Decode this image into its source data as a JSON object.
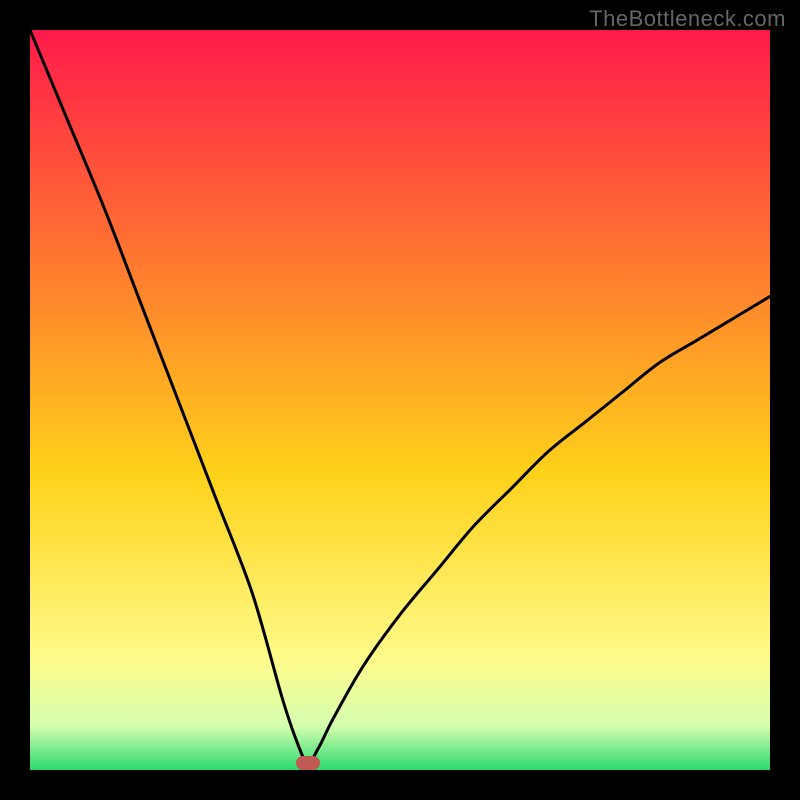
{
  "watermark": "TheBottleneck.com",
  "colors": {
    "frame": "#000000",
    "grad_top": "#ff1a4a",
    "grad_mid1": "#ff7a2f",
    "grad_mid2": "#ffd21a",
    "grad_mid3": "#fffb8a",
    "grad_mid4": "#d6ffb0",
    "grad_bottom": "#2bd96f",
    "curve": "#000000",
    "marker": "#c05a52"
  },
  "chart_data": {
    "type": "line",
    "title": "",
    "xlabel": "",
    "ylabel": "",
    "xlim": [
      0,
      100
    ],
    "ylim": [
      0,
      100
    ],
    "x": [
      0,
      5,
      10,
      15,
      20,
      25,
      30,
      34,
      36,
      37.5,
      39,
      41,
      45,
      50,
      55,
      60,
      65,
      70,
      75,
      80,
      85,
      90,
      95,
      100
    ],
    "y": [
      100,
      88,
      76,
      63,
      50,
      37,
      24,
      10,
      4,
      1,
      3,
      7,
      14,
      21,
      27,
      33,
      38,
      43,
      47,
      51,
      55,
      58,
      61,
      64
    ],
    "marker": {
      "x": 37.5,
      "y": 1
    },
    "note": "x is normalized 0–100 left→right across the gradient area; y is normalized 0 at the green bottom edge to 100 at the top of the gradient. The curve falls from top-left to a minimum near x≈37.5 (marked by the rounded pill), then rises with diminishing slope toward the right edge, reaching roughly 64% height at x=100."
  }
}
